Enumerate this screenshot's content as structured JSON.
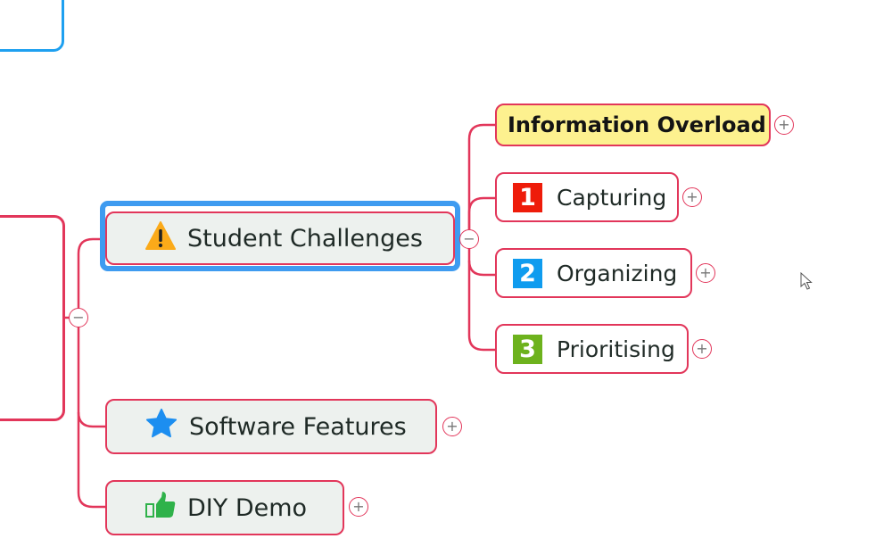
{
  "mindmap": {
    "central_topic_collapse": "−",
    "main_topics": [
      {
        "label": "Student Challenges",
        "icon": "warning-icon",
        "selected": true,
        "toggle": "−",
        "subtopics": [
          {
            "label": "Information Overload",
            "icon": null,
            "highlight": true,
            "toggle": "+"
          },
          {
            "label": "Capturing",
            "icon": "priority-1-icon",
            "badge": "1",
            "badge_color": "#ee1c0a",
            "toggle": "+"
          },
          {
            "label": "Organizing",
            "icon": "priority-2-icon",
            "badge": "2",
            "badge_color": "#0f9cef",
            "toggle": "+"
          },
          {
            "label": "Prioritising",
            "icon": "priority-3-icon",
            "badge": "3",
            "badge_color": "#6db21d",
            "toggle": "+"
          }
        ]
      },
      {
        "label": "Software Features",
        "icon": "star-icon",
        "toggle": "+"
      },
      {
        "label": "DIY Demo",
        "icon": "thumbs-up-icon",
        "toggle": "+"
      }
    ]
  },
  "colors": {
    "branch_line": "#e2365a",
    "selection": "#3e9bf0",
    "root_border": "#1ea0f0",
    "highlight_fill": "#fdf18f",
    "warning": "#fbaa19",
    "star": "#1c8ef0",
    "thumbs_up": "#2fb24a"
  }
}
